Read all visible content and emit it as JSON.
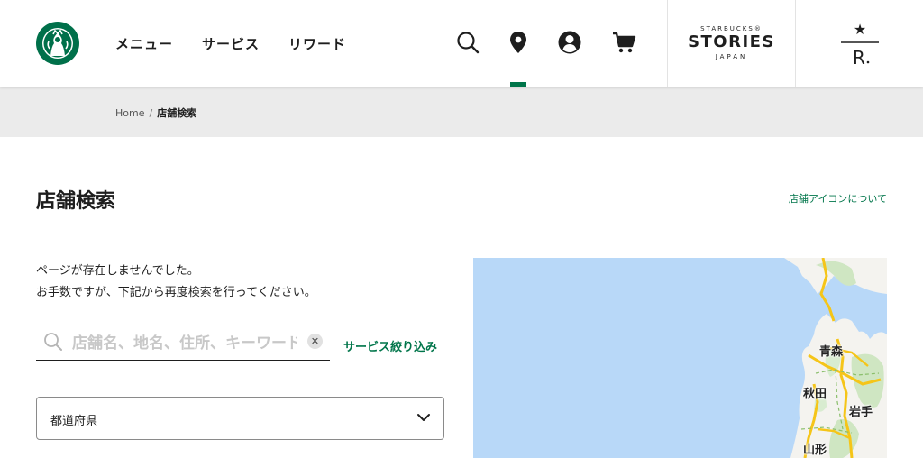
{
  "header": {
    "nav": [
      "メニュー",
      "サービス",
      "リワード"
    ],
    "icons": [
      "search-icon",
      "location-pin-icon",
      "account-icon",
      "cart-icon"
    ],
    "stories": {
      "top": "STARBUCKS®",
      "main": "STORIES",
      "bottom": "JAPAN"
    },
    "reserve": {
      "star": "★",
      "letter": "R"
    }
  },
  "breadcrumb": {
    "home": "Home",
    "separator": "/",
    "current": "店舗検索"
  },
  "main": {
    "title": "店舗検索",
    "icon_link": "店舗アイコンについて",
    "message_line1": "ページが存在しませんでした。",
    "message_line2": "お手数ですが、下記から再度検索を行ってください。",
    "search_placeholder": "店舗名、地名、住所、キーワード",
    "filter_link": "サービス絞り込み",
    "prefecture_select": "都道府県"
  },
  "map": {
    "labels": {
      "aomori": "青森",
      "akita": "秋田",
      "iwate": "岩手",
      "yamagata": "山形"
    }
  },
  "colors": {
    "accent": "#00754a",
    "map_water": "#b8d8f8",
    "map_land": "#f4f3ef",
    "map_forest": "#cfe6c2",
    "map_road": "#f5c518"
  }
}
